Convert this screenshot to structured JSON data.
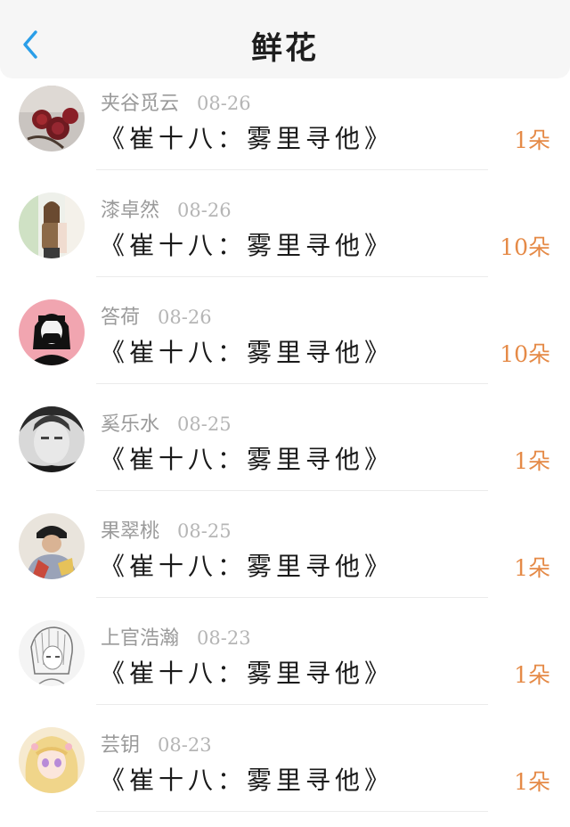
{
  "header": {
    "title": "鲜花",
    "back_icon": "chevron-left-icon",
    "accent_color": "#2a9ee8"
  },
  "records": [
    {
      "name": "夹谷觅云",
      "date": "08-26",
      "book": "《崔十八：雾里寻他》",
      "count": "1朵",
      "avatar": "roses-photo"
    },
    {
      "name": "漆卓然",
      "date": "08-26",
      "book": "《崔十八：雾里寻他》",
      "count": "10朵",
      "avatar": "woman-photo"
    },
    {
      "name": "答荷",
      "date": "08-26",
      "book": "《崔十八：雾里寻他》",
      "count": "10朵",
      "avatar": "masked-girl-illustration"
    },
    {
      "name": "奚乐水",
      "date": "08-25",
      "book": "《崔十八：雾里寻他》",
      "count": "1朵",
      "avatar": "bw-portrait-photo"
    },
    {
      "name": "果翠桃",
      "date": "08-25",
      "book": "《崔十八：雾里寻他》",
      "count": "1朵",
      "avatar": "cap-person-photo"
    },
    {
      "name": "上官浩瀚",
      "date": "08-23",
      "book": "《崔十八：雾里寻他》",
      "count": "1朵",
      "avatar": "manga-sketch"
    },
    {
      "name": "芸钥",
      "date": "08-23",
      "book": "《崔十八：雾里寻他》",
      "count": "1朵",
      "avatar": "anime-girl-illustration"
    }
  ],
  "colors": {
    "count": "#e58a47",
    "name": "#9a9a9a",
    "header_bg": "#f6f6f6"
  }
}
